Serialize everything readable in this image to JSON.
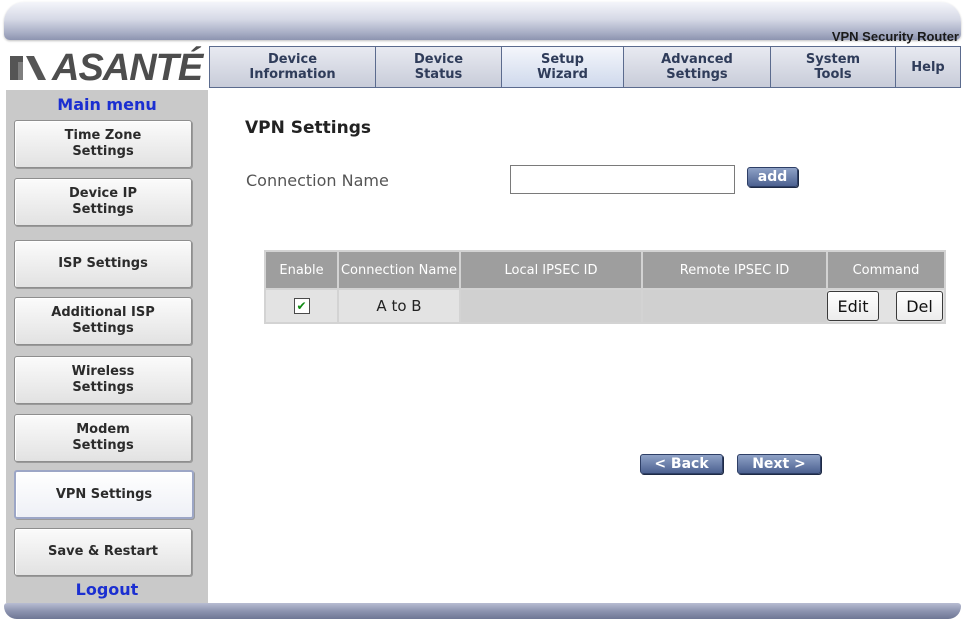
{
  "header": {
    "subtitle": "VPN Security Router"
  },
  "logo": {
    "text": "ASANTÉ"
  },
  "nav": {
    "tabs": [
      {
        "label": "Device\nInformation",
        "active": false
      },
      {
        "label": "Device\nStatus",
        "active": false
      },
      {
        "label": "Setup\nWizard",
        "active": true
      },
      {
        "label": "Advanced\nSettings",
        "active": false
      },
      {
        "label": "System\nTools",
        "active": false
      },
      {
        "label": "Help",
        "active": false
      }
    ]
  },
  "sidebar": {
    "title": "Main menu",
    "items": [
      {
        "label": "Time Zone\nSettings"
      },
      {
        "label": "Device IP\nSettings"
      },
      {
        "label": "ISP Settings"
      },
      {
        "label": "Additional ISP\nSettings"
      },
      {
        "label": "Wireless\nSettings"
      },
      {
        "label": "Modem\nSettings"
      },
      {
        "label": "VPN Settings",
        "active": true
      },
      {
        "label": "Save & Restart"
      }
    ],
    "logout": "Logout"
  },
  "main": {
    "title": "VPN Settings",
    "connection_label": "Connection Name",
    "connection_value": "",
    "add_label": "add",
    "table": {
      "headers": [
        "Enable",
        "Connection Name",
        "Local IPSEC ID",
        "Remote IPSEC ID",
        "Command"
      ],
      "rows": [
        {
          "enabled": true,
          "checkbox_mark": "✔",
          "name": "A to B",
          "local": "",
          "remote": "",
          "edit": "Edit",
          "del": "Del"
        }
      ]
    },
    "back_label": "< Back",
    "next_label": "Next >"
  },
  "colors": {
    "menu_title": "#1b2fd1",
    "sidebar_bg": "#c9c9c9",
    "button_blue": "#4c6190",
    "table_header": "#9e9e9e"
  }
}
